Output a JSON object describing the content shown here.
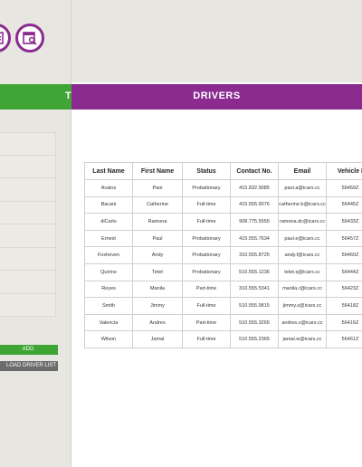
{
  "colors": {
    "purple": "#8b2b8f",
    "green": "#3fa535",
    "gray_button": "#6b6b6b",
    "sidebar_bg": "#e8e6e1"
  },
  "toolbar_icons": [
    "profile-icon",
    "document-search-icon"
  ],
  "sidebar": {
    "section_title": "T",
    "add_button": "ADD",
    "download_button": "LOAD DRIVER LIST"
  },
  "main": {
    "section_title": "DRIVERS",
    "table": {
      "headers": [
        "Last Name",
        "First Name",
        "Status",
        "Contact No.",
        "Email",
        "Vehicle I"
      ],
      "rows": [
        [
          "Avalos",
          "Paoi",
          "Probationary",
          "415.832.9085",
          "paoi.a@icars.cc",
          "56459Z"
        ],
        [
          "Bacani",
          "Catherine",
          "Full-time",
          "415.555.9076",
          "catherine.b@icars.cc",
          "56445Z"
        ],
        [
          "diCarlo",
          "Ramona",
          "Full-time",
          "908.775.5555",
          "ramona.dc@icars.cc",
          "56433Z"
        ],
        [
          "Ernest",
          "Paul",
          "Probationary",
          "415.555.7634",
          "paul.e@icars.cc",
          "56457Z"
        ],
        [
          "Foxhoven",
          "Andy",
          "Probationary",
          "310.555.8725",
          "andy.f@icars.cc",
          "56460Z"
        ],
        [
          "Quirino",
          "Tetet",
          "Probationary",
          "510.555.1236",
          "tetet.q@icars.cc",
          "56444Z"
        ],
        [
          "Reyes",
          "Manila",
          "Part-time",
          "310.555.5341",
          "manila.r@icars.cc",
          "56423Z"
        ],
        [
          "Smith",
          "Jimmy",
          "Full-time",
          "510.555.9815",
          "jimmy.s@icars.cc",
          "56418Z"
        ],
        [
          "Valencia",
          "Andres",
          "Part-time",
          "510.555.3265",
          "andres.v@icars.cc",
          "56416Z"
        ],
        [
          "Wilson",
          "Jamal",
          "Full-time",
          "510.555.2365",
          "jamal.w@icars.cc",
          "56461Z"
        ]
      ]
    }
  }
}
